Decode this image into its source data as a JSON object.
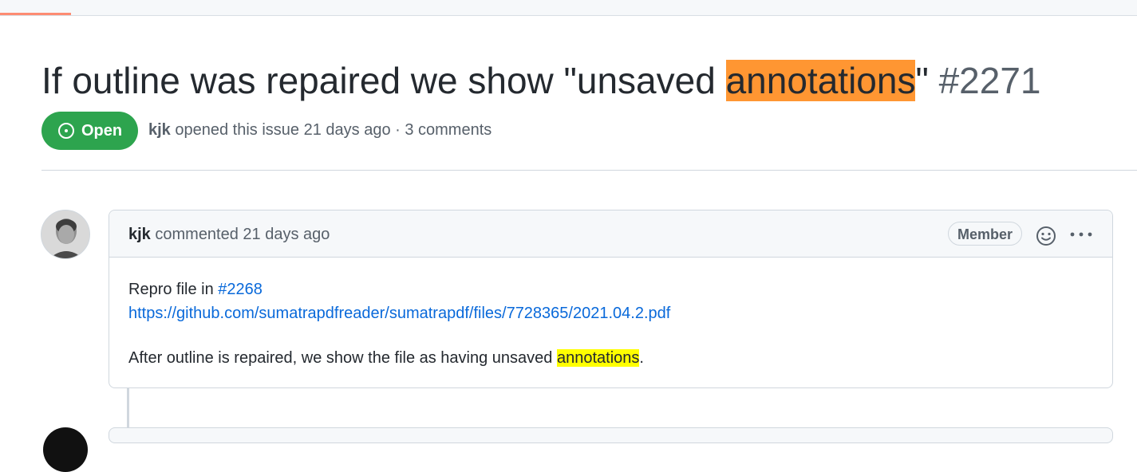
{
  "issue": {
    "title_before": "If outline was repaired we show \"unsaved ",
    "title_highlight": "annotations",
    "title_after": "\" ",
    "number": "#2271",
    "state": "Open",
    "meta": {
      "author": "kjk",
      "opened_text": " opened this issue 21 days ago · 3 comments"
    }
  },
  "comment": {
    "author": "kjk",
    "action_text": " commented 21 days ago",
    "role_badge": "Member",
    "body": {
      "line1_text": "Repro file in ",
      "line1_link": "#2268",
      "line2_link": "https://github.com/sumatrapdfreader/sumatrapdf/files/7728365/2021.04.2.pdf",
      "line3_before": "After outline is repaired, we show the file as having unsaved ",
      "line3_highlight": "annotations",
      "line3_after": "."
    }
  },
  "icons": {
    "state": "issue-opened-icon",
    "reaction": "smiley-icon",
    "menu": "kebab-horizontal-icon"
  },
  "colors": {
    "open_green": "#2da44e",
    "link_blue": "#0969da",
    "title_highlight": "#ff9632",
    "body_highlight": "#ffff00",
    "progress": "#fd8c73"
  }
}
